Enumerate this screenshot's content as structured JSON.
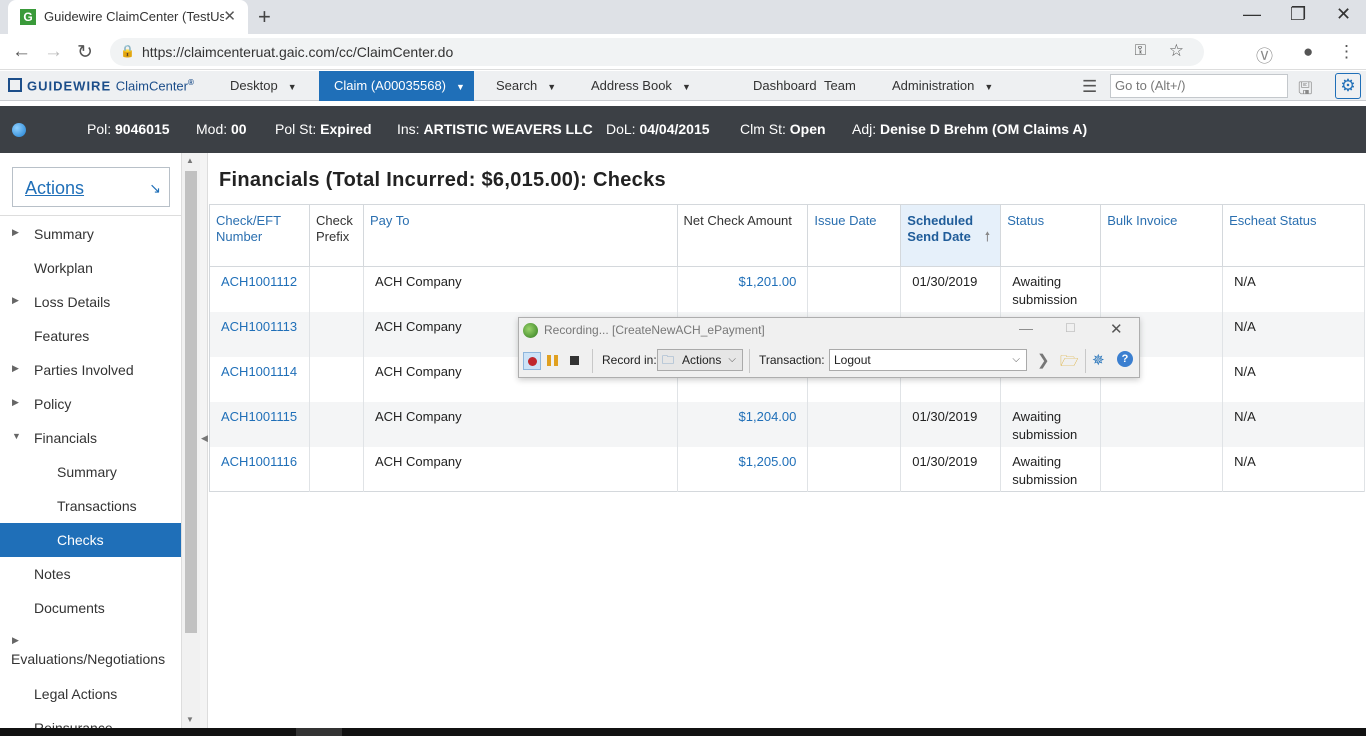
{
  "browser": {
    "tab_title": "Guidewire ClaimCenter (TestUser",
    "url": "https://claimcenteruat.gaic.com/cc/ClaimCenter.do"
  },
  "header": {
    "logo_brand": "GUIDEWIRE",
    "logo_product": "ClaimCenter",
    "logo_reg": "®",
    "menus": {
      "desktop": "Desktop",
      "claim": "Claim (A00035568)",
      "search": "Search",
      "address_book": "Address Book",
      "dashboard": "Dashboard",
      "team": "Team",
      "administration": "Administration"
    },
    "goto_placeholder": "Go to (Alt+/)"
  },
  "infobar": {
    "pol_label": "Pol:",
    "pol_value": "9046015",
    "mod_label": "Mod:",
    "mod_value": "00",
    "polst_label": "Pol St:",
    "polst_value": "Expired",
    "ins_label": "Ins:",
    "ins_value": "ARTISTIC WEAVERS LLC",
    "dol_label": "DoL:",
    "dol_value": "04/04/2015",
    "clmst_label": "Clm St:",
    "clmst_value": "Open",
    "adj_label": "Adj:",
    "adj_value": "Denise D Brehm (OM Claims A)"
  },
  "sidebar": {
    "actions_label": "Actions",
    "items": [
      {
        "label": "Summary"
      },
      {
        "label": "Workplan"
      },
      {
        "label": "Loss Details"
      },
      {
        "label": "Features"
      },
      {
        "label": "Parties Involved"
      },
      {
        "label": "Policy"
      },
      {
        "label": "Financials"
      },
      {
        "label": "Summary"
      },
      {
        "label": "Transactions"
      },
      {
        "label": "Checks"
      },
      {
        "label": "Notes"
      },
      {
        "label": "Documents"
      },
      {
        "label": "Evaluations/Negotiations"
      },
      {
        "label": "Legal Actions"
      },
      {
        "label": "Reinsurance"
      }
    ]
  },
  "main": {
    "title": "Financials (Total Incurred: $6,015.00): Checks",
    "columns": [
      "Check/EFT Number",
      "Check Prefix",
      "Pay To",
      "Net Check Amount",
      "Issue Date",
      "Scheduled Send Date",
      "Status",
      "Bulk Invoice",
      "Escheat Status"
    ],
    "rows": [
      {
        "number": "ACH1001112",
        "prefix": "",
        "pay_to": "ACH Company",
        "amount": "$1,201.00",
        "issue_date": "",
        "send_date": "01/30/2019",
        "status": "Awaiting submission",
        "bulk": "",
        "escheat": "N/A"
      },
      {
        "number": "ACH1001113",
        "prefix": "",
        "pay_to": "ACH Company",
        "amount": "",
        "issue_date": "",
        "send_date": "",
        "status": "",
        "bulk": "",
        "escheat": "N/A"
      },
      {
        "number": "ACH1001114",
        "prefix": "",
        "pay_to": "ACH Company",
        "amount": "",
        "issue_date": "",
        "send_date": "",
        "status": "submission",
        "bulk": "",
        "escheat": "N/A"
      },
      {
        "number": "ACH1001115",
        "prefix": "",
        "pay_to": "ACH Company",
        "amount": "$1,204.00",
        "issue_date": "",
        "send_date": "01/30/2019",
        "status": "Awaiting submission",
        "bulk": "",
        "escheat": "N/A"
      },
      {
        "number": "ACH1001116",
        "prefix": "",
        "pay_to": "ACH Company",
        "amount": "$1,205.00",
        "issue_date": "",
        "send_date": "01/30/2019",
        "status": "Awaiting submission",
        "bulk": "",
        "escheat": "N/A"
      }
    ]
  },
  "recorder": {
    "title": "Recording... [CreateNewACH_ePayment]",
    "record_in_label": "Record in:",
    "record_in_value": "Actions",
    "transaction_label": "Transaction:",
    "transaction_value": "Logout"
  }
}
